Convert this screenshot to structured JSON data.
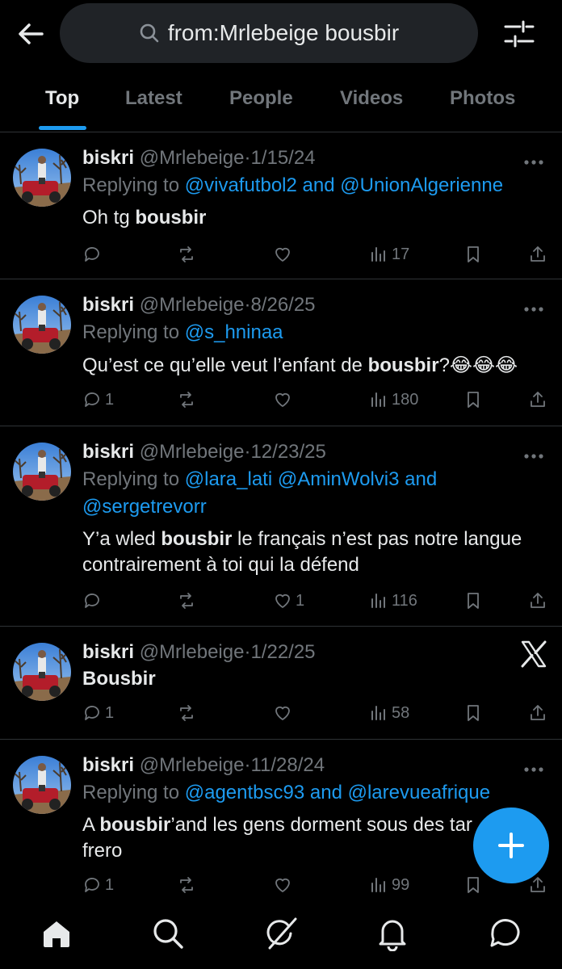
{
  "search": {
    "query": "from:Mrlebeige bousbir"
  },
  "icons": {
    "back": "back-arrow-icon",
    "search": "search-icon",
    "filter": "filter-sliders-icon"
  },
  "tabs": [
    {
      "label": "Top",
      "active": true
    },
    {
      "label": "Latest",
      "active": false
    },
    {
      "label": "People",
      "active": false
    },
    {
      "label": "Videos",
      "active": false
    },
    {
      "label": "Photos",
      "active": false
    }
  ],
  "colors": {
    "accent": "#1d9bf0",
    "background": "#000000",
    "muted": "#71767b",
    "text": "#e7e9ea"
  },
  "posts": [
    {
      "name": "biskri",
      "handle": "@Mrlebeige",
      "sep": "·",
      "date": "1/15/24",
      "reply_prefix": "Replying to",
      "mention1": "@vivafutbol2",
      "and": "and",
      "mention2": "@UnionAlgerienne",
      "text_a": "Oh tg ",
      "text_bold": "bousbir",
      "replies": "",
      "likes": "",
      "views": "17"
    },
    {
      "name": "biskri",
      "handle": "@Mrlebeige",
      "sep": "·",
      "date": "8/26/25",
      "reply_prefix": "Replying to",
      "mention1": "@s_hninaa",
      "text_a": "Qu’est ce qu’elle veut l’enfant de ",
      "text_bold": "bousbir",
      "text_b": "?😂😂😂",
      "replies": "1",
      "likes": "",
      "views": "180"
    },
    {
      "name": "biskri",
      "handle": "@Mrlebeige",
      "sep": "·",
      "date": "12/23/25",
      "reply_prefix": "Replying to",
      "mention1": "@lara_lati",
      "mention2": "@AminWolvi3",
      "and": "and",
      "mention3": "@sergetrevorr",
      "text_a": "Y’a wled ",
      "text_bold": "bousbir",
      "text_b": " le français n’est pas notre langue",
      "text_line2": "contrairement à toi qui la défend",
      "replies": "",
      "likes": "1",
      "views": "116"
    },
    {
      "name": "biskri",
      "handle": "@Mrlebeige",
      "sep": "·",
      "date": "1/22/25",
      "text_bold": "Bousbir",
      "replies": "1",
      "likes": "",
      "views": "58"
    },
    {
      "name": "biskri",
      "handle": "@Mrlebeige",
      "sep": "·",
      "date": "11/28/24",
      "reply_prefix": "Replying to",
      "mention1": "@agentbsc93",
      "and": "and",
      "mention2": "@larevueafrique",
      "text_a": "A ",
      "text_bold": "bousbir",
      "text_b": "’and les gens dorment sous des tar",
      "text_line2": "frero",
      "replies": "1",
      "likes": "",
      "views": "99"
    }
  ],
  "fab": {
    "icon": "plus-icon"
  },
  "bottom_nav": [
    "home-icon",
    "explore-search-icon",
    "grok-icon",
    "notifications-bell-icon",
    "messages-icon"
  ]
}
